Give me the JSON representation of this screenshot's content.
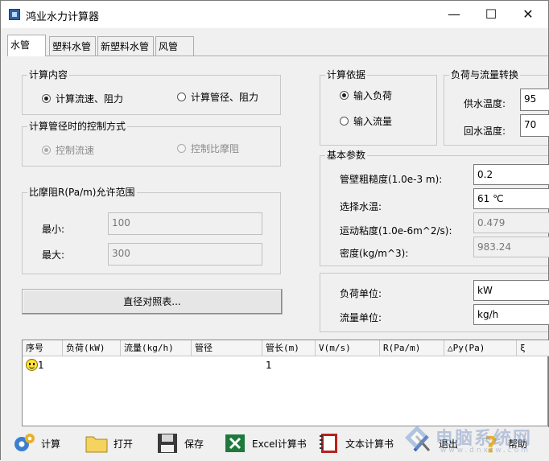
{
  "window": {
    "title": "鸿业水力计算器",
    "minimize": "—",
    "maximize": "☐",
    "close": "✕"
  },
  "tabs": [
    "水管",
    "塑料水管",
    "新塑料水管",
    "风管"
  ],
  "calc_content": {
    "legend": "计算内容",
    "options": [
      {
        "label": "计算流速、阻力",
        "selected": true
      },
      {
        "label": "计算管径、阻力",
        "selected": false
      }
    ]
  },
  "control_mode": {
    "legend": "计算管径时的控制方式",
    "options": [
      {
        "label": "控制流速",
        "selected": true
      },
      {
        "label": "控制比摩阻",
        "selected": false
      }
    ]
  },
  "friction_range": {
    "legend": "比摩阻R(Pa/m)允许范围",
    "min_label": "最小:",
    "min_value": "100",
    "max_label": "最大:",
    "max_value": "300"
  },
  "diameter_button": "直径对照表...",
  "calc_basis": {
    "legend": "计算依据",
    "options": [
      {
        "label": "输入负荷",
        "selected": true
      },
      {
        "label": "输入流量",
        "selected": false
      }
    ]
  },
  "load_flow": {
    "legend": "负荷与流量转换",
    "supply_label": "供水温度:",
    "supply_value": "95",
    "return_label": "回水温度:",
    "return_value": "70"
  },
  "basic_params": {
    "legend": "基本参数",
    "roughness_label": "管壁粗糙度(1.0e-3 m):",
    "roughness_value": "0.2",
    "temp_label": "选择水温:",
    "temp_value": "61 ℃",
    "viscosity_label": "运动粘度(1.0e-6m^2/s):",
    "viscosity_value": "0.479",
    "density_label": "密度(kg/m^3):",
    "density_value": "983.24"
  },
  "units": {
    "load_label": "负荷单位:",
    "load_value": "kW",
    "flow_label": "流量单位:",
    "flow_value": "kg/h"
  },
  "grid": {
    "columns": [
      "序号",
      "负荷(kW)",
      "流量(kg/h)",
      "管径",
      "管长(m)",
      "V(m/s)",
      "R(Pa/m)",
      "△Py(Pa)",
      "ξ"
    ],
    "rows": [
      {
        "index": "1",
        "length": "1"
      }
    ]
  },
  "toolbar": {
    "calc": "计算",
    "open": "打开",
    "save": "保存",
    "excel": "Excel计算书",
    "text": "文本计算书",
    "exit": "退出",
    "help": "帮助"
  },
  "watermark": {
    "text": "电脑系统网",
    "url": "www.dnxtw.com"
  },
  "colors": {
    "accent": "#2f5f9f",
    "panel": "#f0f0f0",
    "border": "#adadad",
    "smiley": "#ffe23a"
  }
}
